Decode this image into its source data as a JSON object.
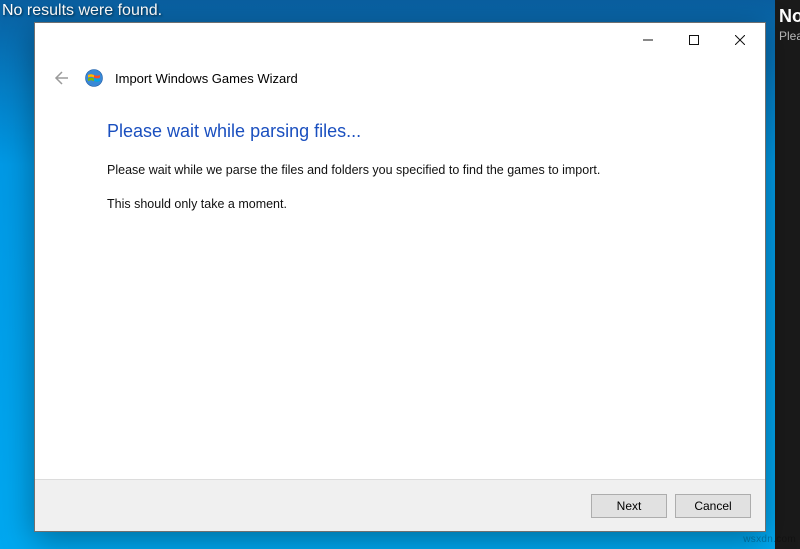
{
  "desktop": {
    "status_text": "No results were found."
  },
  "side_panel": {
    "title_fragment": "No",
    "sub_fragment": "Plea"
  },
  "dialog": {
    "window_title": "Import Windows Games Wizard",
    "heading": "Please wait while parsing files...",
    "body_line1": "Please wait while we parse the files and folders you specified to find the games to import.",
    "body_line2": "This should only take a moment.",
    "buttons": {
      "next": "Next",
      "cancel": "Cancel"
    }
  },
  "watermark": "wsxdn.com"
}
